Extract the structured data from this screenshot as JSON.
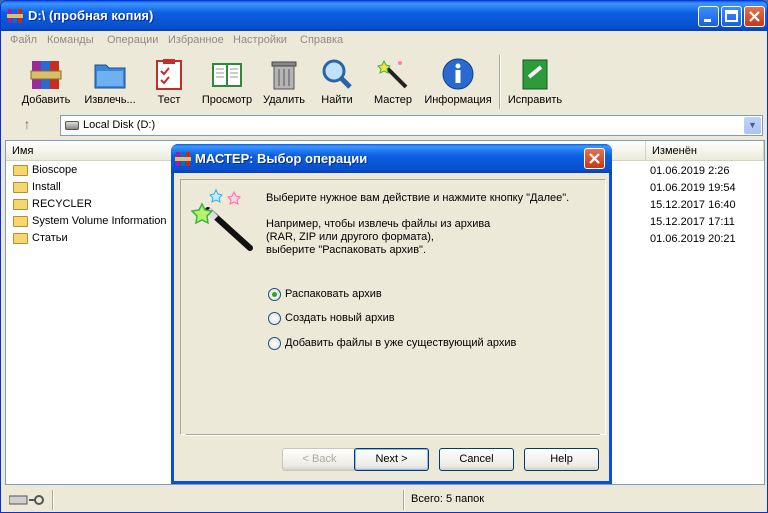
{
  "window": {
    "title": "D:\\ (пробная копия)"
  },
  "menu": [
    "Файл",
    "Команды",
    "Операции",
    "Избранное",
    "Настройки",
    "Справка"
  ],
  "toolbar": {
    "buttons": [
      {
        "label": "Добавить",
        "icon": "archive-add-icon"
      },
      {
        "label": "Извлечь...",
        "icon": "folder-extract-icon"
      },
      {
        "label": "Тест",
        "icon": "clipboard-check-icon"
      },
      {
        "label": "Просмотр",
        "icon": "book-view-icon"
      },
      {
        "label": "Удалить",
        "icon": "trash-can-icon"
      },
      {
        "label": "Найти",
        "icon": "magnifier-icon"
      },
      {
        "label": "Мастер",
        "icon": "magic-wand-icon"
      },
      {
        "label": "Информация",
        "icon": "info-icon"
      },
      {
        "label": "Исправить",
        "icon": "repair-kit-icon"
      }
    ]
  },
  "address": {
    "path": "Local Disk (D:)"
  },
  "list": {
    "columns": {
      "name": "Имя",
      "modified": "Изменён"
    },
    "rows": [
      {
        "name": "Bioscope",
        "modified": "01.06.2019 2:26"
      },
      {
        "name": "Install",
        "modified": "01.06.2019 19:54"
      },
      {
        "name": "RECYCLER",
        "modified": "15.12.2017 16:40"
      },
      {
        "name": "System Volume Information",
        "modified": "15.12.2017 17:11"
      },
      {
        "name": "Статьи",
        "modified": "01.06.2019 20:21"
      }
    ]
  },
  "status": {
    "text": "Всего: 5 папок"
  },
  "dialog": {
    "title": "МАСТЕР:  Выбор операции",
    "intro": "Выберите нужное вам действие и нажмите кнопку \"Далее\".",
    "example_line1": "Например, чтобы извлечь файлы из архива",
    "example_line2": "(RAR, ZIP или другого формата),",
    "example_line3": "выберите \"Распаковать архив\".",
    "options": [
      {
        "label": "Распаковать архив",
        "selected": true
      },
      {
        "label": "Создать новый архив",
        "selected": false
      },
      {
        "label": "Добавить файлы в уже существующий архив",
        "selected": false
      }
    ],
    "buttons": {
      "back": "< Back",
      "next": "Next >",
      "cancel": "Cancel",
      "help": "Help"
    }
  },
  "colors": {
    "titlebar": "#0a5ee6",
    "window_bg": "#ece9d8",
    "selected_radio": "#2fa51f"
  }
}
